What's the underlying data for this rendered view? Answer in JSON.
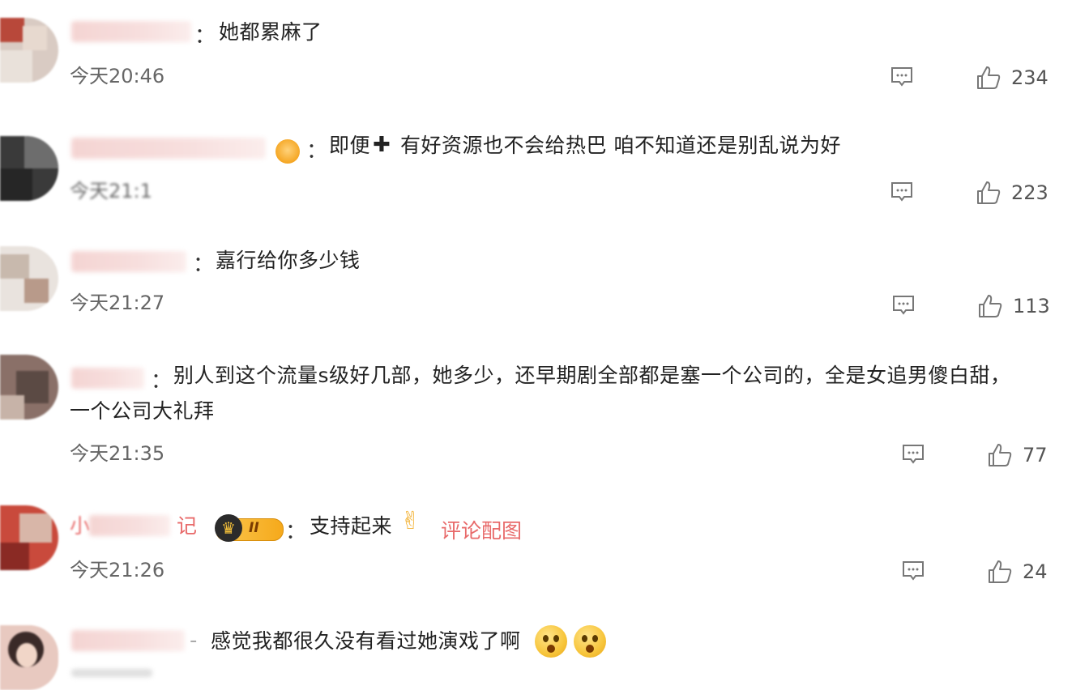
{
  "comments": [
    {
      "text": "她都累麻了",
      "time": "今天20:46",
      "likes": "234"
    },
    {
      "text_a": "即便",
      "text_b": "有好资源也不会给热巴 咱不知道还是别乱说为好",
      "time": "今天21:1",
      "likes": "223"
    },
    {
      "text": "嘉行给你多少钱",
      "time": "今天21:27",
      "likes": "113"
    },
    {
      "text_line1": "别人到这个流量s级好几部，她多少，还早期剧全部都是塞一个公司的，全是女追男傻白甜，",
      "text_line2": "一个公司大礼拜",
      "time": "今天21:35",
      "likes": "77"
    },
    {
      "text": "支持起来",
      "badge_level": "II",
      "username_visible_a": "小",
      "username_visible_b": "记",
      "link": "评论配图",
      "time": "今天21:26",
      "likes": "24"
    },
    {
      "text": "感觉我都很久没有看过她演戏了啊",
      "username_tail": "-"
    }
  ],
  "colon": "：",
  "icons": {
    "reply": "comment-reply-icon",
    "like": "thumbs-up-icon",
    "emoji_victory": "victory-hand-emoji",
    "emoji_surprised": "surprised-face-emoji",
    "vip": "vip-crown-badge"
  },
  "colors": {
    "link": "#e86a6a",
    "badge": "#f6a91b"
  }
}
